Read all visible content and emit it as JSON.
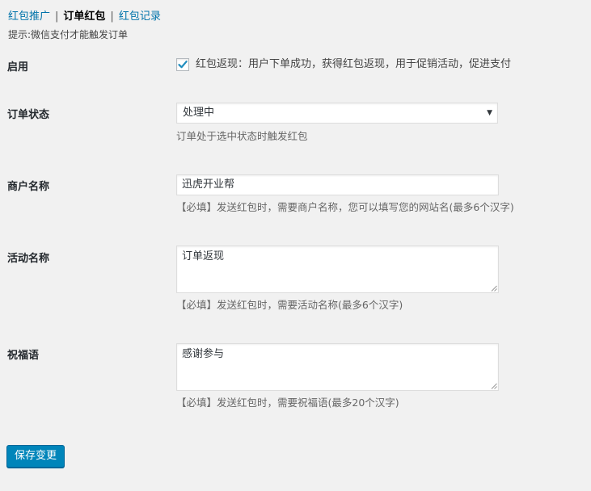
{
  "subnav": {
    "tab1": "红包推广",
    "tab2": "订单红包",
    "tab3": "红包记录",
    "separator": "|"
  },
  "hint": "提示:微信支付才能触发订单",
  "enable": {
    "label": "启用",
    "checked": true,
    "checkbox_text": "红包返现：用户下单成功，获得红包返现，用于促销活动，促进支付"
  },
  "order_status": {
    "label": "订单状态",
    "selected": "处理中",
    "description": "订单处于选中状态时触发红包"
  },
  "merchant_name": {
    "label": "商户名称",
    "value": "迅虎开业帮",
    "description": "【必填】发送红包时，需要商户名称，您可以填写您的网站名(最多6个汉字)"
  },
  "activity_name": {
    "label": "活动名称",
    "value": "订单返现",
    "description": "【必填】发送红包时，需要活动名称(最多6个汉字)"
  },
  "blessing": {
    "label": "祝福语",
    "value": "感谢参与",
    "description": "【必填】发送红包时，需要祝福语(最多20个汉字)"
  },
  "save_button": "保存变更"
}
